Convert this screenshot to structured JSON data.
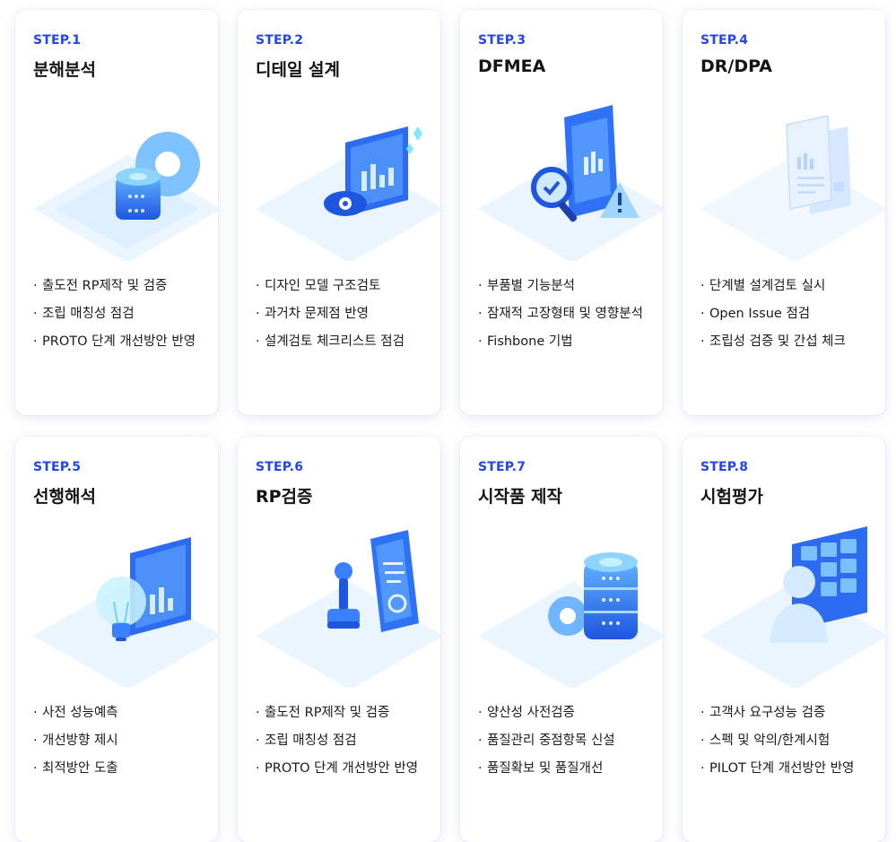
{
  "steps": [
    {
      "step": "STEP.1",
      "title": "분해분석",
      "icon": "database-gear-icon",
      "items": [
        "출도전 RP제작 및 검증",
        "조립 매칭성 점검",
        "PROTO 단계 개선방안 반영"
      ]
    },
    {
      "step": "STEP.2",
      "title": "디테일 설계",
      "icon": "chart-eye-icon",
      "items": [
        "디자인 모델 구조검토",
        "과거차 문제점 반영",
        "설계검토 체크리스트 점검"
      ]
    },
    {
      "step": "STEP.3",
      "title": "DFMEA",
      "icon": "document-search-warning-icon",
      "items": [
        "부품별 기능분석",
        "잠재적 고장형태 및 영향분석",
        "Fishbone 기법"
      ]
    },
    {
      "step": "STEP.4",
      "title": "DR/DPA",
      "icon": "documents-icon",
      "items": [
        "단계별 설계검토 실시",
        "Open Issue 점검",
        "조립성 검증 및 간섭 체크"
      ]
    },
    {
      "step": "STEP.5",
      "title": "선행해석",
      "icon": "lightbulb-chart-icon",
      "items": [
        "사전 성능예측",
        "개선방향 제시",
        "최적방안 도출"
      ]
    },
    {
      "step": "STEP.6",
      "title": "RP검증",
      "icon": "stamp-document-icon",
      "items": [
        "출도전 RP제작 및 검증",
        "조립 매칭성 점검",
        "PROTO 단계 개선방안 반영"
      ]
    },
    {
      "step": "STEP.7",
      "title": "시작품 제작",
      "icon": "database-gear-icon",
      "items": [
        "양산성 사전검증",
        "품질관리 중점항목 신설",
        "품질확보 및 품질개선"
      ]
    },
    {
      "step": "STEP.8",
      "title": "시험평가",
      "icon": "user-dashboard-icon",
      "items": [
        "고객사 요구성능 검증",
        "스펙 및 악의/한계시험",
        "PILOT 단계 개선방안 반영"
      ]
    }
  ],
  "colors": {
    "accent": "#2147e8",
    "illustration_light": "#bfe3ff",
    "illustration_dark": "#1e56e0"
  }
}
